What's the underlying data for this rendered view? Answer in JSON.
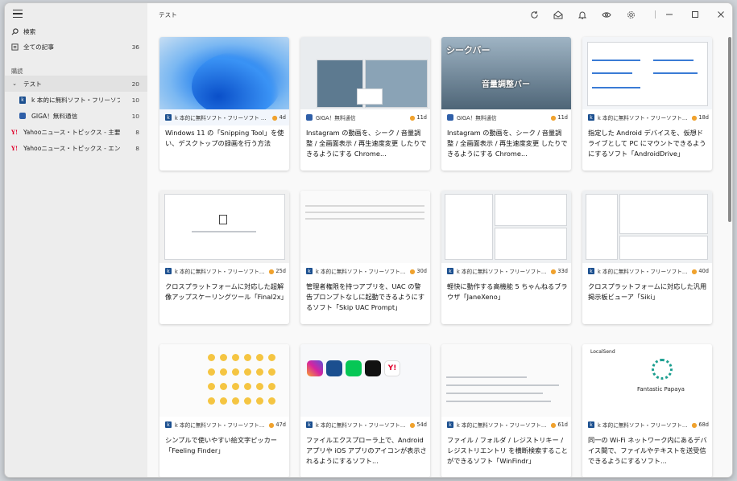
{
  "sidebar": {
    "search_label": "検索",
    "all_articles": {
      "label": "全ての記事",
      "count": "36"
    },
    "section_label": "購読",
    "items": [
      {
        "label": "テスト",
        "count": "20"
      },
      {
        "label": "k 本的に無料ソフト・フリーソフト 更新...",
        "count": "10"
      },
      {
        "label": "GIGA！無料通信",
        "count": "10"
      },
      {
        "label": "Yahooニュース・トピックス - 主要",
        "count": "8"
      },
      {
        "label": "Yahooニュース・トピックス - エンタメ",
        "count": "8"
      }
    ]
  },
  "topbar": {
    "title": "テスト"
  },
  "cards": [
    {
      "source": "k 本的に無料ソフト・フリーソフト 更新...",
      "age": "4d",
      "title": "Windows 11 の「Snipping Tool」を使い、デスクトップの録画を行う方法"
    },
    {
      "source": "GIGA！無料通信",
      "age": "11d",
      "title": "Instagram の動画を、シーク / 音量調整 / 全画面表示 / 再生速度変更 したりできるようにする Chrome..."
    },
    {
      "source": "GIGA！無料通信",
      "age": "11d",
      "title": "Instagram の動画を、シーク / 音量調整 / 全画面表示 / 再生速度変更 したりできるようにする Chrome..."
    },
    {
      "source": "k 本的に無料ソフト・フリーソフト 更...",
      "age": "18d",
      "title": "指定した Android デバイスを、仮想ドライブとして PC にマウントできるようにするソフト「AndroidDrive」"
    },
    {
      "source": "k 本的に無料ソフト・フリーソフト 更...",
      "age": "25d",
      "title": "クロスプラットフォームに対応した超解像アップスケーリングツール「Final2x」"
    },
    {
      "source": "k 本的に無料ソフト・フリーソフト 更...",
      "age": "30d",
      "title": "管理者権限を持つアプリを、UAC の警告プロンプトなしに起動できるようにするソフト「Skip UAC Prompt」"
    },
    {
      "source": "k 本的に無料ソフト・フリーソフト 更...",
      "age": "33d",
      "title": "軽快に動作する高機能 5 ちゃんねるブラウザ「JaneXeno」"
    },
    {
      "source": "k 本的に無料ソフト・フリーソフト 更...",
      "age": "40d",
      "title": "クロスプラットフォームに対応した汎用掲示板ビューア「Siki」"
    },
    {
      "source": "k 本的に無料ソフト・フリーソフト 更...",
      "age": "47d",
      "title": "シンプルで使いやすい絵文字ピッカー「Feeling Finder」"
    },
    {
      "source": "k 本的に無料ソフト・フリーソフト 更...",
      "age": "54d",
      "title": "ファイルエクスプローラ上で、Android アプリや iOS アプリのアイコンが表示されるようにするソフト..."
    },
    {
      "source": "k 本的に無料ソフト・フリーソフト 更...",
      "age": "61d",
      "title": "ファイル / フォルダ / レジストリキー / レジストリエントリ を横断検索することができるソフト「WinFindr」"
    },
    {
      "source": "k 本的に無料ソフト・フリーソフト 更...",
      "age": "68d",
      "title": "同一の Wi-Fi ネットワーク内にあるデバイス間で、ファイルやテキストを送受信できるようにするソフト..."
    }
  ],
  "thumb_text": {
    "seek_bar": "シークバー",
    "volume_bar": "音量調整バー",
    "localsend": "LocalSend",
    "fantastic_papaya": "Fantastic Papaya"
  }
}
